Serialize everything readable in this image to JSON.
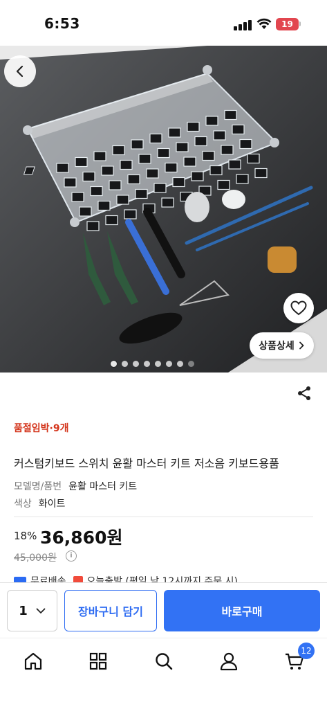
{
  "status_bar": {
    "time": "6:53",
    "battery": "19"
  },
  "hero": {
    "detail_label": "상품상세",
    "page_dots": 8,
    "active_dot": 0
  },
  "product": {
    "badge": "품절임박·9개",
    "title": "커스텀키보드 스위치 윤활 마스터 키트 저소음 키보드용품",
    "specs": [
      {
        "key": "모델명/품번",
        "value": "윤활 마스터 키트"
      },
      {
        "key": "색상",
        "value": "화이트"
      }
    ],
    "discount": "18%",
    "price": "36,860원",
    "original_price": "45,000원",
    "shipping": "무료배송",
    "delivery": "오늘출발 (평일 낮 12시까지 주문 시)"
  },
  "purchase_bar": {
    "quantity": "1",
    "cart_label": "장바구니 담기",
    "buy_label": "바로구매"
  },
  "tabbar": {
    "items": [
      "home-icon",
      "category-grid-icon",
      "search-icon",
      "profile-icon",
      "cart-icon"
    ],
    "cart_count": "12"
  },
  "colors": {
    "accent": "#3272f4",
    "badge": "#d4351c"
  }
}
